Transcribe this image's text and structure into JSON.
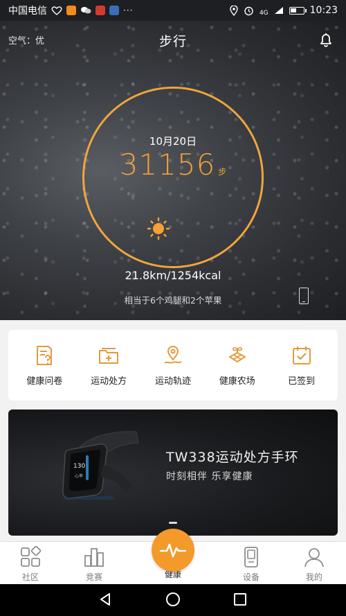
{
  "status_bar": {
    "carrier": "中国电信",
    "network": "4G",
    "time": "10:23",
    "icons": [
      "heart-rate-icon",
      "taobao-icon",
      "wechat-icon",
      "weibo-icon",
      "app-icon",
      "more-dots-icon",
      "location-icon",
      "alarm-icon",
      "signal-icon",
      "battery-icon"
    ]
  },
  "header": {
    "air_quality": "空气：优",
    "title": "步行"
  },
  "steps_panel": {
    "date": "10月20日",
    "steps": "31156",
    "unit": "步",
    "weather_icon": "sun-icon",
    "distance_calories": "21.8km/1254kcal",
    "equivalent": "相当于6个鸡腿和2个苹果"
  },
  "features": [
    {
      "label": "健康问卷",
      "icon": "questionnaire-icon"
    },
    {
      "label": "运动处方",
      "icon": "prescription-folder-icon"
    },
    {
      "label": "运动轨迹",
      "icon": "location-pin-icon"
    },
    {
      "label": "健康农场",
      "icon": "farm-sprout-icon"
    },
    {
      "label": "已签到",
      "icon": "calendar-check-icon"
    }
  ],
  "banner": {
    "title": "TW338运动处方手环",
    "subtitle": "时刻相伴 乐享健康",
    "band_display": "130",
    "band_label": "心率"
  },
  "tabbar": {
    "items": [
      {
        "label": "社区",
        "icon": "community-icon"
      },
      {
        "label": "竞赛",
        "icon": "competition-icon"
      },
      {
        "label": "健康",
        "icon": "heartbeat-icon"
      },
      {
        "label": "设备",
        "icon": "device-icon"
      },
      {
        "label": "我的",
        "icon": "profile-icon"
      }
    ],
    "active": "健康"
  },
  "colors": {
    "accent": "#f39a2b",
    "ring": "#f2a43c",
    "icon_orange": "#e39a3b"
  }
}
